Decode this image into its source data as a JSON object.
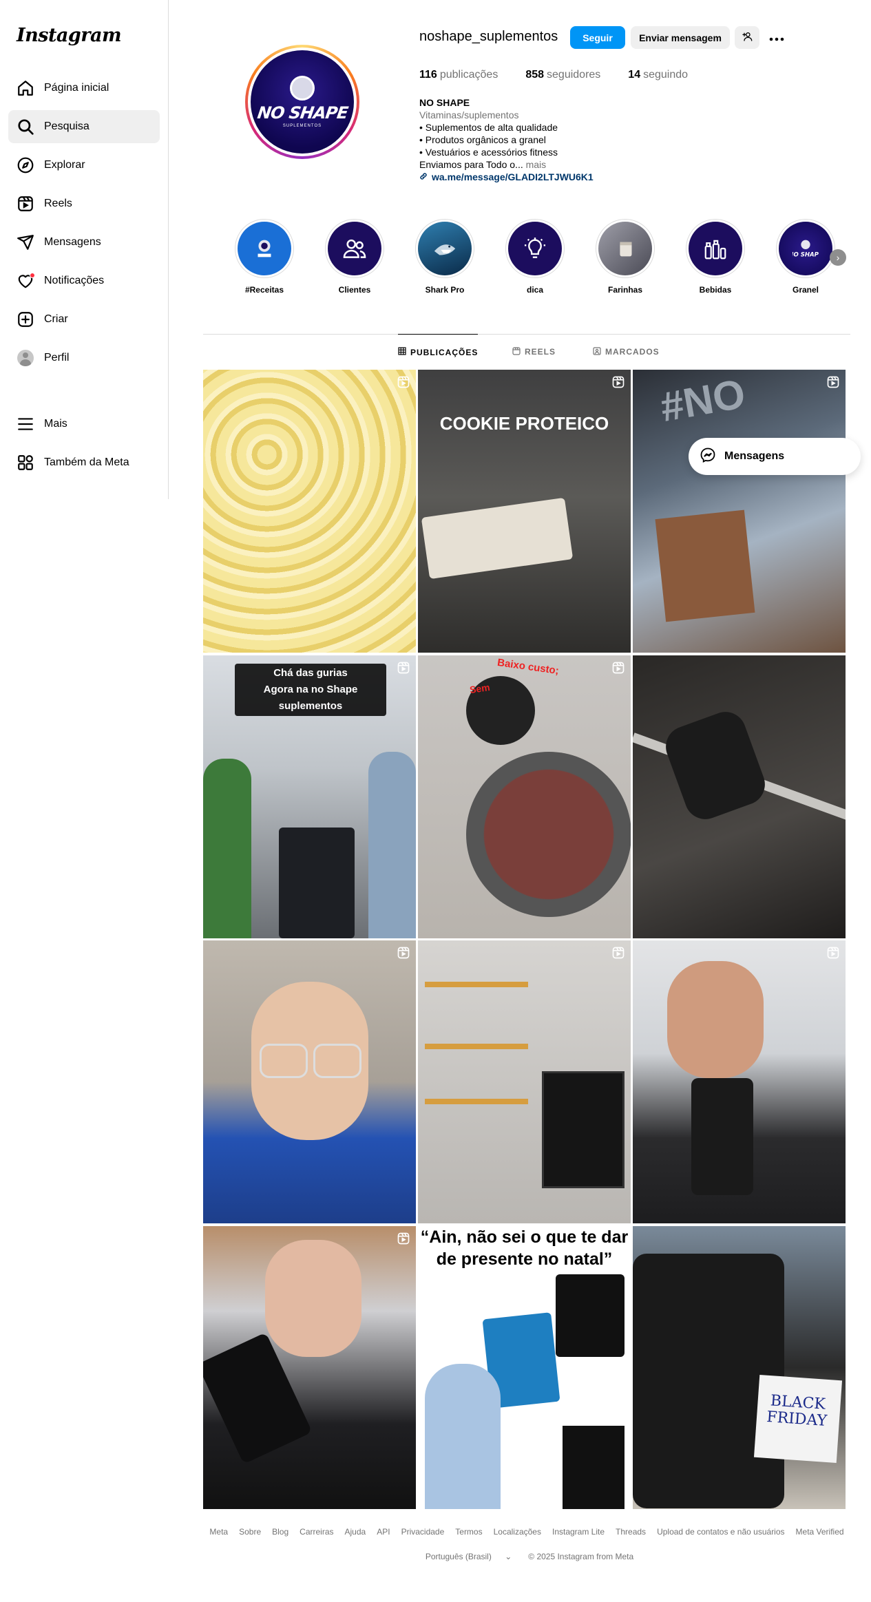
{
  "app": {
    "logo": "Instagram"
  },
  "sidebar": {
    "items": [
      {
        "label": "Página inicial",
        "icon": "home-icon"
      },
      {
        "label": "Pesquisa",
        "icon": "search-icon"
      },
      {
        "label": "Explorar",
        "icon": "compass-icon"
      },
      {
        "label": "Reels",
        "icon": "reels-icon"
      },
      {
        "label": "Mensagens",
        "icon": "send-icon"
      },
      {
        "label": "Notificações",
        "icon": "heart-icon"
      },
      {
        "label": "Criar",
        "icon": "plus-square-icon"
      },
      {
        "label": "Perfil",
        "icon": "avatar"
      }
    ],
    "more": {
      "label": "Mais",
      "icon": "menu-icon"
    },
    "meta": {
      "label": "Também da Meta",
      "icon": "meta-apps-icon"
    },
    "active_index": 1
  },
  "profile": {
    "username": "noshape_suplementos",
    "avatar_brand": "NO SHAPE",
    "avatar_sub": "SUPLEMENTOS",
    "follow_label": "Seguir",
    "message_label": "Enviar mensagem",
    "stats": {
      "posts_count": "116",
      "posts_label": "publicações",
      "followers_count": "858",
      "followers_label": "seguidores",
      "following_count": "14",
      "following_label": "seguindo"
    },
    "bio": {
      "name": "NO SHAPE",
      "category": "Vitaminas/suplementos",
      "lines": [
        "• Suplementos de alta qualidade",
        "• Produtos orgânicos a granel",
        "• Vestuários e acessórios fitness"
      ],
      "truncated": "Enviamos para Todo o...",
      "more_label": "mais",
      "link": "wa.me/message/GLADI2LTJWU6K1"
    }
  },
  "highlights": [
    {
      "label": "#Receitas",
      "color": "#1a6fd6"
    },
    {
      "label": "Clientes",
      "color": "#1c0d5e"
    },
    {
      "label": "Shark Pro",
      "color": "#0a2a48"
    },
    {
      "label": "dica",
      "color": "#1c0d5e"
    },
    {
      "label": "Farinhas",
      "color": "#6b6b78"
    },
    {
      "label": "Bebidas",
      "color": "#1c0d5e"
    },
    {
      "label": "Granel",
      "color": "#1c0d5e"
    }
  ],
  "tabs": [
    {
      "label": "PUBLICAÇÕES",
      "active": true
    },
    {
      "label": "REELS",
      "active": false
    },
    {
      "label": "MARCADOS",
      "active": false
    }
  ],
  "posts": [
    {
      "caption": "",
      "reel": true
    },
    {
      "caption": "COOKIE PROTEICO",
      "reel": true
    },
    {
      "caption": "#NO",
      "reel": true
    },
    {
      "caption": "Chá das gurias\nAgora na no Shape suplementos",
      "reel": true
    },
    {
      "caption": "Baixo custo;",
      "caption2": "Sem",
      "reel": true
    },
    {
      "caption": "",
      "reel": false
    },
    {
      "caption": "",
      "reel": true
    },
    {
      "caption": "",
      "reel": true
    },
    {
      "caption": "",
      "reel": true
    },
    {
      "caption": "",
      "reel": true
    },
    {
      "caption": "“Ain, não sei o que te dar de presente no natal”",
      "reel": false
    },
    {
      "caption": "BLACK FRIDAY",
      "reel": false
    }
  ],
  "floating": {
    "label": "Mensagens"
  },
  "footer": {
    "links": [
      "Meta",
      "Sobre",
      "Blog",
      "Carreiras",
      "Ajuda",
      "API",
      "Privacidade",
      "Termos",
      "Localizações",
      "Instagram Lite",
      "Threads",
      "Upload de contatos e não usuários",
      "Meta Verified"
    ],
    "language": "Português (Brasil)",
    "copyright": "© 2025 Instagram from Meta"
  }
}
